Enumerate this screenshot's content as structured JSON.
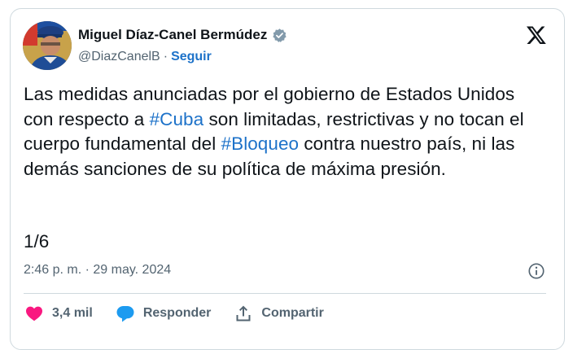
{
  "author": {
    "name": "Miguel Díaz-Canel Bermúdez",
    "handle": "@DiazCanelB",
    "separator": "·",
    "follow_label": "Seguir"
  },
  "tweet": {
    "segments": [
      {
        "text": "Las medidas anunciadas por el gobierno de Estados Unidos con respecto a ",
        "hashtag": false
      },
      {
        "text": "#Cuba",
        "hashtag": true
      },
      {
        "text": " son limitadas, restrictivas y no tocan el cuerpo fundamental del ",
        "hashtag": false
      },
      {
        "text": "#Bloqueo",
        "hashtag": true
      },
      {
        "text": " contra nuestro país, ni las demás sanciones de su política de máxima presión.",
        "hashtag": false
      }
    ],
    "thread_counter": "1/6",
    "timestamp": "2:46 p. m. · 29 may. 2024"
  },
  "actions": {
    "likes": "3,4 mil",
    "reply_label": "Responder",
    "share_label": "Compartir"
  },
  "colors": {
    "link": "#1d72c9",
    "like": "#f91880",
    "reply": "#1d9bf0",
    "muted": "#536471"
  },
  "icons": [
    "verified-badge-icon",
    "x-logo-icon",
    "info-icon",
    "heart-icon",
    "reply-bubble-icon",
    "share-icon"
  ]
}
